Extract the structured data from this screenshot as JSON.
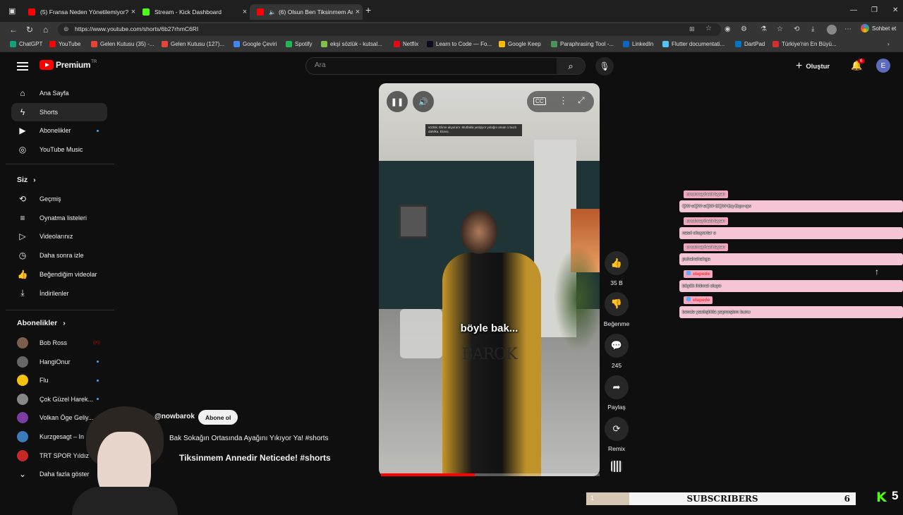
{
  "browser": {
    "tabs": [
      {
        "title": "(5) Fransa Neden Yönetilemiyor?",
        "color": "#ff0000",
        "active": false
      },
      {
        "title": "Stream - Kick Dashboard",
        "color": "#53fc18",
        "active": false
      },
      {
        "title": "(6) Olsun Ben Tiksinmem Anı",
        "color": "#ff0000",
        "active": true
      }
    ],
    "url": "https://www.youtube.com/shorts/6b27rhmC6RI",
    "chat_button": "Sohbet et",
    "bookmarks": [
      {
        "label": "ChatGPT",
        "color": "#10a37f"
      },
      {
        "label": "YouTube",
        "color": "#ff0000"
      },
      {
        "label": "Gelen Kutusu (35) -...",
        "color": "#ea4335"
      },
      {
        "label": "Gelen Kutusu (127)...",
        "color": "#ea4335"
      },
      {
        "label": "Google Çeviri",
        "color": "#4285f4"
      },
      {
        "label": "Spotify",
        "color": "#1db954"
      },
      {
        "label": "ekşi sözlük - kutsal...",
        "color": "#81c14b"
      },
      {
        "label": "Netflix",
        "color": "#e50914"
      },
      {
        "label": "Learn to Code — Fo...",
        "color": "#0a0a23"
      },
      {
        "label": "Google Keep",
        "color": "#fbbc04"
      },
      {
        "label": "Paraphrasing Tool -...",
        "color": "#499557"
      },
      {
        "label": "LinkedIn",
        "color": "#0a66c2"
      },
      {
        "label": "Flutter documentati...",
        "color": "#54c5f8"
      },
      {
        "label": "DartPad",
        "color": "#0175c2"
      },
      {
        "label": "Türkiye'nin En Büyü...",
        "color": "#d32f2f"
      }
    ]
  },
  "header": {
    "logo": "Premium",
    "logo_tm": "TR",
    "search_placeholder": "Ara",
    "create_label": "Oluştur",
    "notif_count": "6",
    "avatar_letter": "E"
  },
  "sidebar": {
    "main": [
      {
        "label": "Ana Sayfa",
        "icon": "home-icon",
        "active": false
      },
      {
        "label": "Shorts",
        "icon": "shorts-icon",
        "active": true
      },
      {
        "label": "Abonelikler",
        "icon": "subscriptions-icon",
        "active": false
      },
      {
        "label": "YouTube Music",
        "icon": "music-icon",
        "active": false
      }
    ],
    "you_title": "Siz",
    "you": [
      {
        "label": "Geçmiş",
        "icon": "history-icon"
      },
      {
        "label": "Oynatma listeleri",
        "icon": "playlist-icon"
      },
      {
        "label": "Videolarınız",
        "icon": "videos-icon"
      },
      {
        "label": "Daha sonra izle",
        "icon": "clock-icon"
      },
      {
        "label": "Beğendiğim videolar",
        "icon": "like-icon"
      },
      {
        "label": "İndirilenler",
        "icon": "download-icon"
      }
    ],
    "subs_title": "Abonelikler",
    "subs": [
      {
        "label": "Bob Ross",
        "color": "#7b5e4b",
        "live": true
      },
      {
        "label": "HangiOnur",
        "color": "#666666",
        "live": false
      },
      {
        "label": "Flu",
        "color": "#f4c20d",
        "live": false
      },
      {
        "label": "Çok Güzel Harek...",
        "color": "#888888",
        "live": false
      },
      {
        "label": "Volkan Öge Geliy...",
        "color": "#7a3fa0",
        "live": false
      },
      {
        "label": "Kurzgesagt – In ...",
        "color": "#3b7bbf",
        "live": false
      },
      {
        "label": "TRT SPOR Yıldız",
        "color": "#c62828",
        "live": false
      }
    ],
    "more": "Daha fazla göster"
  },
  "video": {
    "caption_box": "sözlük. Elime alıyorum. Mutfakla yetişiyor yolağın aman 1 buzlı dahilka. Bravo.",
    "subtitle": "böyle bak...",
    "watermark": "BAROK",
    "progress": 0.43
  },
  "actions": {
    "likes": "35 B",
    "dislike": "Beğenme",
    "comments": "245",
    "share": "Paylaş",
    "remix": "Remix"
  },
  "channel": {
    "handle": "@nowbarok",
    "subscribe": "Abone ol",
    "desc1": "Bak Sokağın Ortasında Ayağını Yıkıyor Ya! #shorts",
    "desc2": "Tiksinmem Annedir Neticede! #shorts"
  },
  "chat": [
    {
      "user": "unutmayihatirlayan",
      "msg": "QW-eQW-eQW-EQW-Eq-Eqw-qw",
      "red": false
    },
    {
      "user": "unutmayihatirlayan",
      "msg": "nasıl okuyorlar o",
      "red": false
    },
    {
      "user": "unutmayihatirlayan",
      "msg": "puhahahahga",
      "red": false
    },
    {
      "user": "elapede",
      "msg": "büyük ihtimal oluyo",
      "red": true
    },
    {
      "user": "elapede",
      "msg": "bende yanlışlıkla yapmıştım bunu",
      "red": true
    }
  ],
  "stream_overlay": {
    "subs_label": "SUBSCRIBERS",
    "subs_current": "1",
    "subs_goal": "6",
    "subs_progress": 0.16,
    "kick_count": "5"
  }
}
